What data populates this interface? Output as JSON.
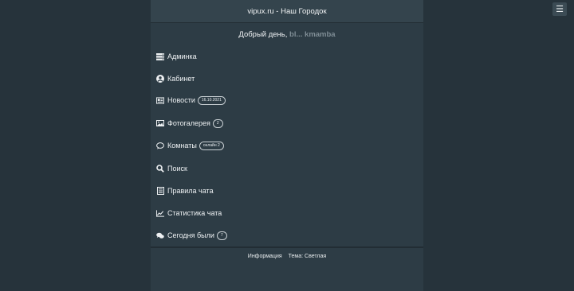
{
  "header": {
    "title": "vipux.ru - Наш Городок"
  },
  "menu_icon": "hamburger-icon",
  "greeting": {
    "text": "Добрый день, ",
    "nickname": "bl... kmamba"
  },
  "menu": [
    {
      "label": "Админка",
      "icon": "server-icon"
    },
    {
      "label": "Кабинет",
      "icon": "user-circle-icon"
    },
    {
      "label": "Новости",
      "icon": "newspaper-icon",
      "badge": "16.10.2021"
    },
    {
      "label": "Фотогалерея",
      "icon": "image-icon",
      "badge": "2"
    },
    {
      "label": "Комнаты",
      "icon": "chat-bubble-icon",
      "badge": "онлайн 2"
    },
    {
      "label": "Поиск",
      "icon": "search-icon"
    },
    {
      "label": "Правила чата",
      "icon": "rules-list-icon"
    },
    {
      "label": "Статистика чата",
      "icon": "line-chart-icon"
    },
    {
      "label": "Сегодня были",
      "icon": "comments-icon",
      "badge": "7"
    }
  ],
  "footer": {
    "info": "Информация",
    "theme": "Тема: Светлая"
  },
  "colors": {
    "background": "#26333b",
    "panel": "#2d3c45",
    "header": "#34444d"
  }
}
